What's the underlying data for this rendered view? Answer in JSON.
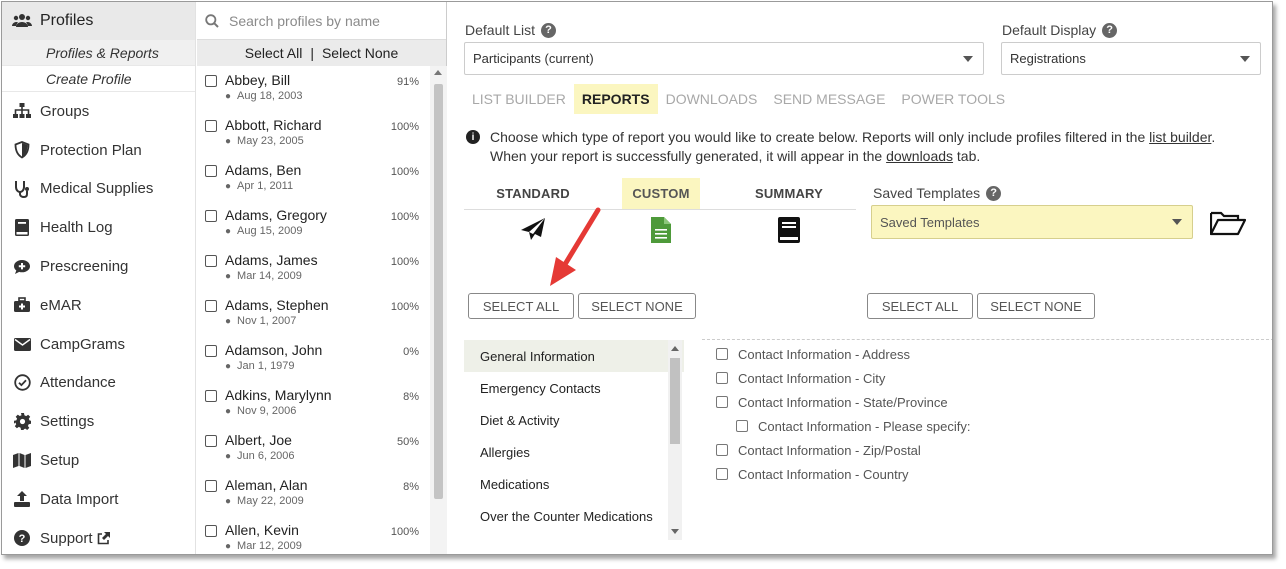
{
  "nav": {
    "header": "Profiles",
    "subitems": [
      "Profiles & Reports",
      "Create Profile"
    ],
    "items": [
      {
        "label": "Groups",
        "icon": "sitemap-icon"
      },
      {
        "label": "Protection Plan",
        "icon": "shield-icon"
      },
      {
        "label": "Medical Supplies",
        "icon": "stethoscope-icon"
      },
      {
        "label": "Health Log",
        "icon": "book-icon"
      },
      {
        "label": "Prescreening",
        "icon": "comment-medical-icon"
      },
      {
        "label": "eMAR",
        "icon": "briefcase-medical-icon"
      },
      {
        "label": "CampGrams",
        "icon": "envelope-icon"
      },
      {
        "label": "Attendance",
        "icon": "check-circle-icon"
      },
      {
        "label": "Settings",
        "icon": "gear-icon"
      },
      {
        "label": "Setup",
        "icon": "map-icon"
      },
      {
        "label": "Data Import",
        "icon": "upload-icon"
      },
      {
        "label": "Support",
        "icon": "question-circle-icon"
      }
    ]
  },
  "profiles": {
    "search_placeholder": "Search profiles by name",
    "select_all": "Select All",
    "separator": "|",
    "select_none": "Select None",
    "rows": [
      {
        "name": "Abbey, Bill",
        "date": "Aug 18, 2003",
        "pct": "91%"
      },
      {
        "name": "Abbott, Richard",
        "date": "May 23, 2005",
        "pct": "100%"
      },
      {
        "name": "Adams, Ben",
        "date": "Apr 1, 2011",
        "pct": "100%"
      },
      {
        "name": "Adams, Gregory",
        "date": "Aug 15, 2009",
        "pct": "100%"
      },
      {
        "name": "Adams, James",
        "date": "Mar 14, 2009",
        "pct": "100%"
      },
      {
        "name": "Adams, Stephen",
        "date": "Nov 1, 2007",
        "pct": "100%"
      },
      {
        "name": "Adamson, John",
        "date": "Jan 1, 1979",
        "pct": "0%"
      },
      {
        "name": "Adkins, Marylynn",
        "date": "Nov 9, 2006",
        "pct": "8%"
      },
      {
        "name": "Albert, Joe",
        "date": "Jun 6, 2006",
        "pct": "50%"
      },
      {
        "name": "Aleman, Alan",
        "date": "May 22, 2009",
        "pct": "8%"
      },
      {
        "name": "Allen, Kevin",
        "date": "Mar 12, 2009",
        "pct": "100%"
      }
    ]
  },
  "main": {
    "default_list_label": "Default List",
    "default_list_value": "Participants (current)",
    "default_display_label": "Default Display",
    "default_display_value": "Registrations",
    "tabs": [
      "LIST BUILDER",
      "REPORTS",
      "DOWNLOADS",
      "SEND MESSAGE",
      "POWER TOOLS"
    ],
    "active_tab": "REPORTS",
    "info": {
      "part1": "Choose which type of report you would like to create below. Reports will only include profiles filtered in the ",
      "link1": "list builder",
      "part2": ".",
      "part3": "When your report is successfully generated, it will appear in the ",
      "link2": "downloads",
      "part4": " tab."
    },
    "report_types": [
      "STANDARD",
      "CUSTOM",
      "SUMMARY"
    ],
    "active_report_type": "CUSTOM",
    "saved_templates_label": "Saved Templates",
    "saved_templates_value": "Saved Templates",
    "select_all_btn": "SELECT ALL",
    "select_none_btn": "SELECT NONE",
    "categories": [
      "General Information",
      "Emergency Contacts",
      "Diet & Activity",
      "Allergies",
      "Medications",
      "Over the Counter Medications"
    ],
    "fields": [
      {
        "label": "Contact Information - Address",
        "indent": false
      },
      {
        "label": "Contact Information - City",
        "indent": false
      },
      {
        "label": "Contact Information - State/Province",
        "indent": false
      },
      {
        "label": "Contact Information - Please specify:",
        "indent": true
      },
      {
        "label": "Contact Information - Zip/Postal",
        "indent": false
      },
      {
        "label": "Contact Information - Country",
        "indent": false
      }
    ],
    "colors": {
      "highlight": "#fbf6c0",
      "arrow": "#e53935"
    }
  }
}
